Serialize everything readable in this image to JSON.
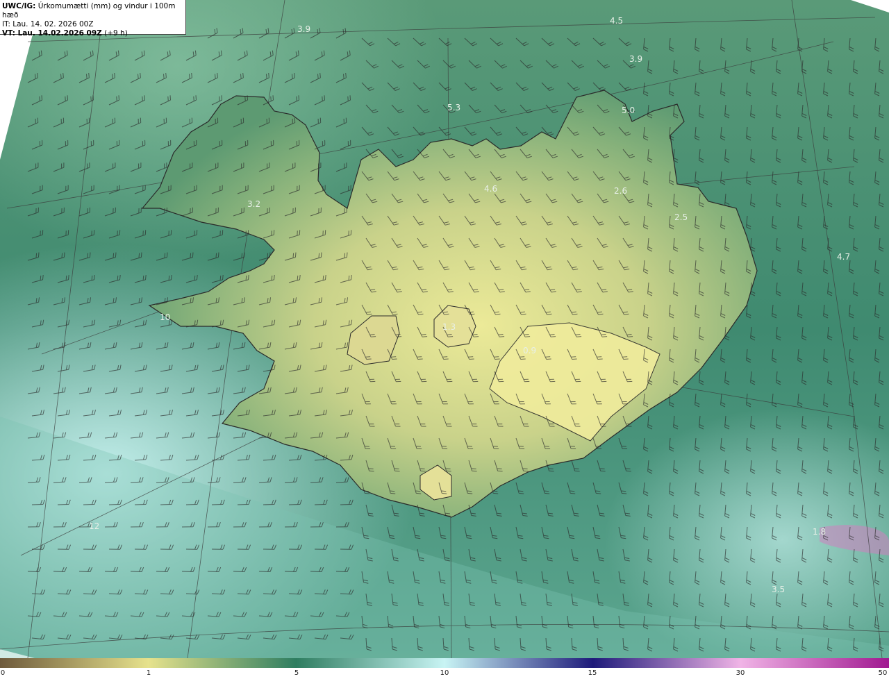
{
  "header": {
    "product_code": "UWC/IG:",
    "product_title": "Úrkomumætti (mm) og vindur i 100m hæð",
    "it_line": "IT: Lau. 14. 02. 2026 00Z",
    "vt_prefix": "VT: Lau. 14.02.2026 09Z",
    "vt_suffix": "(+9 h)"
  },
  "map": {
    "region": "Iceland",
    "value_labels": [
      "4.5",
      "3.9",
      "3.9",
      "5.3",
      "5.0",
      "4.6",
      "2.6",
      "3.2",
      "2.5",
      "4.7",
      "0.9",
      "3.5",
      "10",
      "12",
      "1.3",
      "1.8"
    ]
  },
  "colorbar": {
    "tick_labels": [
      "0",
      "1",
      "5",
      "10",
      "15",
      "30",
      "50"
    ],
    "colors": {
      "c0": "#6e5a3c",
      "c1": "#e6e28c",
      "c5": "#2e7d60",
      "c10": "#c8f4f4",
      "c15": "#1e1a7a",
      "c30": "#f0b4e6",
      "c50": "#a01890"
    }
  }
}
